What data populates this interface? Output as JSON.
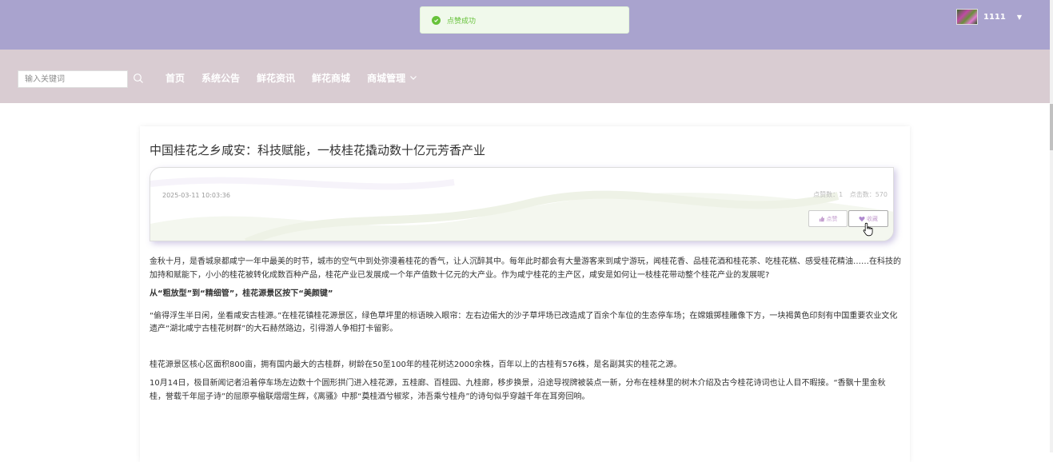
{
  "toast": {
    "text": "点赞成功"
  },
  "user": {
    "name": "1111"
  },
  "search": {
    "placeholder": "输入关键词"
  },
  "nav": {
    "items": [
      "首页",
      "系统公告",
      "鲜花资讯",
      "鲜花商城"
    ],
    "dropdown_label": "商城管理"
  },
  "article": {
    "title": "中国桂花之乡咸安：科技赋能，一枝桂花撬动数十亿元芳香产业",
    "date": "2025-03-11 10:03:36",
    "likes_label": "点赞数：1",
    "clicks_label": "点击数：570",
    "like_button": "点赞",
    "favorite_button": "收藏",
    "paragraphs": [
      "金秋十月，是香城泉都咸宁一年中最美的时节，城市的空气中到处弥漫着桂花的香气，让人沉醉其中。每年此时都会有大量游客来到咸宁游玩，闻桂花香、品桂花酒和桂花茶、吃桂花糕、感受桂花精油……在科技的加持和赋能下，小小的桂花被转化成数百种产品，桂花产业已发展成一个年产值数十亿元的大产业。作为咸宁桂花的主产区，咸安是如何让一枝桂花带动整个桂花产业的发展呢?",
      "从“粗放型”到“精细管”，桂花源景区按下“美颜键”",
      "“偷得浮生半日闲，坐看咸安古桂源。”在桂花镇桂花源景区，绿色草坪里的标语映入眼帘：左右边偌大的沙子草坪场已改造成了百余个车位的生态停车场；在嫦娥掷桂雕像下方，一块褐黄色印刻有中国重要农业文化遗产“湖北咸宁古桂花树群”的大石赫然路边，引得游人争相打卡留影。",
      "桂花源景区核心区面积800亩，拥有国内最大的古桂群，树龄在50至100年的桂花树达2000余株，百年以上的古桂有576株，是名副其实的桂花之源。",
      "10月14日，极目新闻记者沿着停车场左边数十个圆形拱门进入桂花源，五桂廊、百桂园、九桂廊，移步换景，沿途导视牌被装点一新，分布在桂林里的树木介绍及古今桂花诗词也让人目不暇接。“香飘十里金秋桂，誉载千年屈子诗”的屈原亭楹联熠熠生辉，《离骚》中那“奠桂酒兮椒浆，沛吾乘兮桂舟”的诗句似乎穿越千年在耳旁回响。"
    ]
  },
  "colors": {
    "topbar": "#a9a3ce",
    "navbar": "#d9ccd2",
    "success": "#67c23a"
  },
  "icons": [
    "check-circle-icon",
    "search-icon",
    "chevron-down-icon",
    "thumbs-up-icon",
    "heart-icon",
    "hand-pointer-icon"
  ]
}
